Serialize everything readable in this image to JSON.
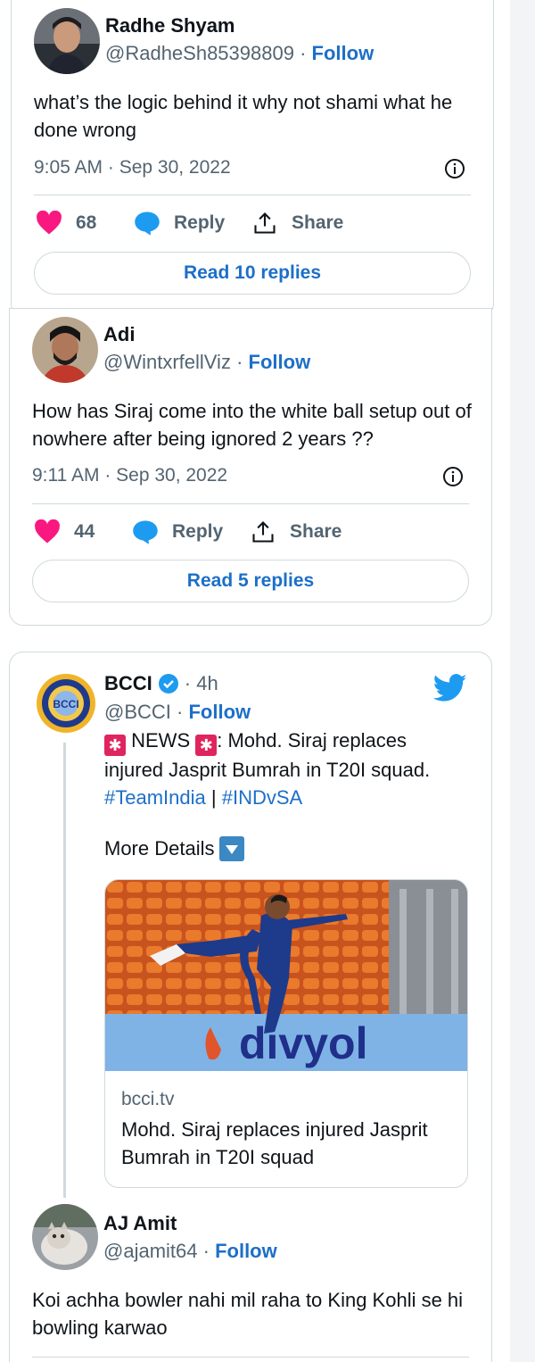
{
  "tweets": [
    {
      "name": "Radhe Shyam",
      "handle": "@RadheSh85398809",
      "separator": "·",
      "follow": "Follow",
      "text": "what’s the logic behind it why not shami what he done wrong",
      "time": "9:05 AM · Sep 30, 2022",
      "likes": "68",
      "reply": "Reply",
      "share": "Share",
      "read_replies": "Read 10 replies"
    },
    {
      "name": "Adi",
      "handle": "@WintxrfellViz",
      "separator": "·",
      "follow": "Follow",
      "text": "How has Siraj come into the white ball setup out of nowhere after being ignored 2 years ??",
      "time": "9:11 AM · Sep 30, 2022",
      "likes": "44",
      "reply": "Reply",
      "share": "Share",
      "read_replies": "Read 5 replies"
    }
  ],
  "quoted": {
    "name": "BCCI",
    "age": "· 4h",
    "handle": "@BCCI",
    "separator": "·",
    "follow": "Follow",
    "news_word": "NEWS",
    "news_rest": ": Mohd. Siraj replaces injured Jasprit Bumrah in T20I squad.",
    "hashtag1": "#TeamIndia",
    "hashtag_sep": "|",
    "hashtag2": "#INDvSA",
    "more_details": "More Details",
    "link_domain": "bcci.tv",
    "link_title": "Mohd. Siraj replaces injured Jasprit Bumrah in T20I squad",
    "banner_text": "divyol",
    "emblem_text": "BCCI"
  },
  "reply": {
    "name": "AJ Amit",
    "handle": "@ajamit64",
    "separator": "·",
    "follow": "Follow",
    "text": "Koi achha bowler nahi mil raha to King Kohli se hi bowling karwao"
  },
  "colors": {
    "heart": "#f91880",
    "reply_bubble": "#1d9bf0",
    "link_blue": "#1d6fc8",
    "twitter_bird": "#1d9bf0",
    "verified": "#1d9bf0",
    "siren": "#e0245e",
    "down_arrow_box": "#3b88c3"
  },
  "icons": [
    "heart-icon",
    "reply-bubble-icon",
    "share-icon",
    "info-icon",
    "verified-icon",
    "twitter-bird-icon",
    "siren-icon",
    "down-arrow-icon"
  ]
}
